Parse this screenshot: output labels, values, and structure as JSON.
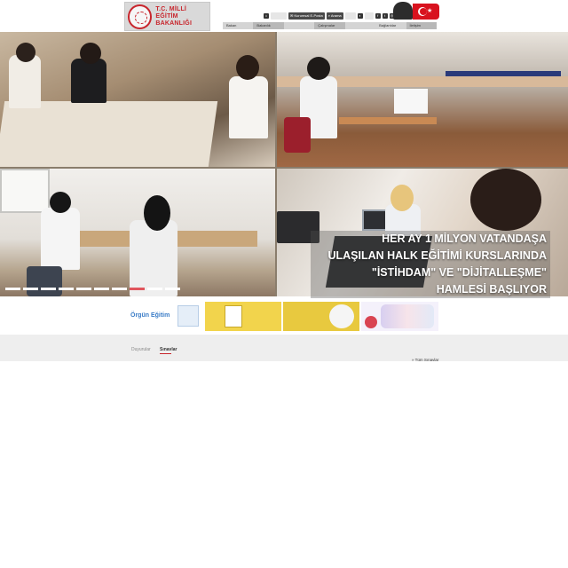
{
  "header": {
    "logo_line1": "T.C. MİLLİ EĞİTİM",
    "logo_line2": "BAKANLIĞI",
    "topbar": {
      "home_icon": "home-icon",
      "hidden_label": "",
      "kurumsal_posta": "Kurumsal E-Posta",
      "arama": "Arama",
      "social_icons": [
        "facebook-icon",
        "twitter-icon",
        "instagram-icon",
        "youtube-icon"
      ]
    },
    "menu": [
      "Bakan",
      "Bakanlık",
      "",
      "Çalışmalar",
      "",
      "Bağlantılar",
      "İletişim"
    ]
  },
  "banner": {
    "headline_lines": [
      "HER AY 1 MİLYON VATANDAŞA",
      "ULAŞILAN HALK EĞİTİMİ KURSLARINDA",
      "\"İSTİHDAM\" VE \"DİJİTALLEŞME\"",
      "HAMLESİ BAŞLIYOR"
    ],
    "slide_count": 10,
    "active_slide": 7
  },
  "promos": {
    "orgun_egitim": "Örgün Eğitim"
  },
  "tabs": {
    "duyurular": "Duyurular",
    "sinavlar": "Sınavlar",
    "active": "sinavlar",
    "all_link": "» Tüm Sınavlar"
  },
  "colors": {
    "brand_red": "#c8262d",
    "menu_bg": "#d4d4d4",
    "section_bg": "#eeeeee"
  }
}
